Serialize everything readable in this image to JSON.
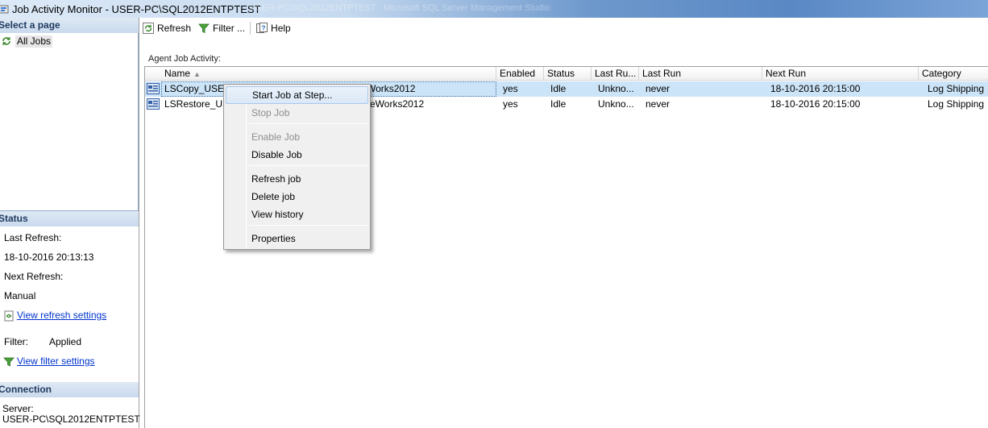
{
  "window": {
    "title": "Job Activity Monitor - USER-PC\\SQL2012ENTPTEST",
    "ghost_title": "USER-PC\\SQL2012ENTPTEST - Microsoft SQL Server Management Studio"
  },
  "left_panel": {
    "select_page_header": "Select a page",
    "pages": [
      {
        "label": "All Jobs"
      }
    ],
    "status_header": "Status",
    "last_refresh_label": "Last Refresh:",
    "last_refresh_value": "18-10-2016 20:13:13",
    "next_refresh_label": "Next Refresh:",
    "next_refresh_value": "Manual",
    "view_refresh_settings": "View refresh settings",
    "filter_label": "Filter:",
    "filter_value": "Applied",
    "view_filter_settings": "View filter settings",
    "connection_header": "Connection",
    "server_label": "Server:",
    "server_value": "USER-PC\\SQL2012ENTPTEST"
  },
  "toolbar": {
    "refresh": "Refresh",
    "filter": "Filter ...",
    "help": "Help"
  },
  "grid": {
    "label": "Agent Job Activity:",
    "columns": [
      "Name",
      "Enabled",
      "Status",
      "Last Ru...",
      "Last Run",
      "Next Run",
      "Category"
    ],
    "rows": [
      {
        "name_visible_start": "LSCopy_USER",
        "name_visible_end": "Works2012",
        "enabled": "yes",
        "status": "Idle",
        "last_run_outcome": "Unkno...",
        "last_run": "never",
        "next_run": "18-10-2016 20:15:00",
        "category": "Log Shipping"
      },
      {
        "name_visible_start": "LSRestore_US",
        "name_visible_end": "eWorks2012",
        "enabled": "yes",
        "status": "Idle",
        "last_run_outcome": "Unkno...",
        "last_run": "never",
        "next_run": "18-10-2016 20:15:00",
        "category": "Log Shipping"
      }
    ]
  },
  "context_menu": {
    "items": [
      {
        "label": "Start Job at Step...",
        "enabled": true,
        "hover": true
      },
      {
        "label": "Stop Job",
        "enabled": false
      },
      {
        "label": "Enable Job",
        "enabled": false
      },
      {
        "label": "Disable Job",
        "enabled": true
      },
      {
        "label": "Refresh job",
        "enabled": true
      },
      {
        "label": "Delete job",
        "enabled": true
      },
      {
        "label": "View history",
        "enabled": true
      },
      {
        "label": "Properties",
        "enabled": true
      }
    ]
  },
  "colors": {
    "selection": "#cce4f7",
    "link": "#0033cc",
    "section_header_text": "#1f3a5f"
  }
}
